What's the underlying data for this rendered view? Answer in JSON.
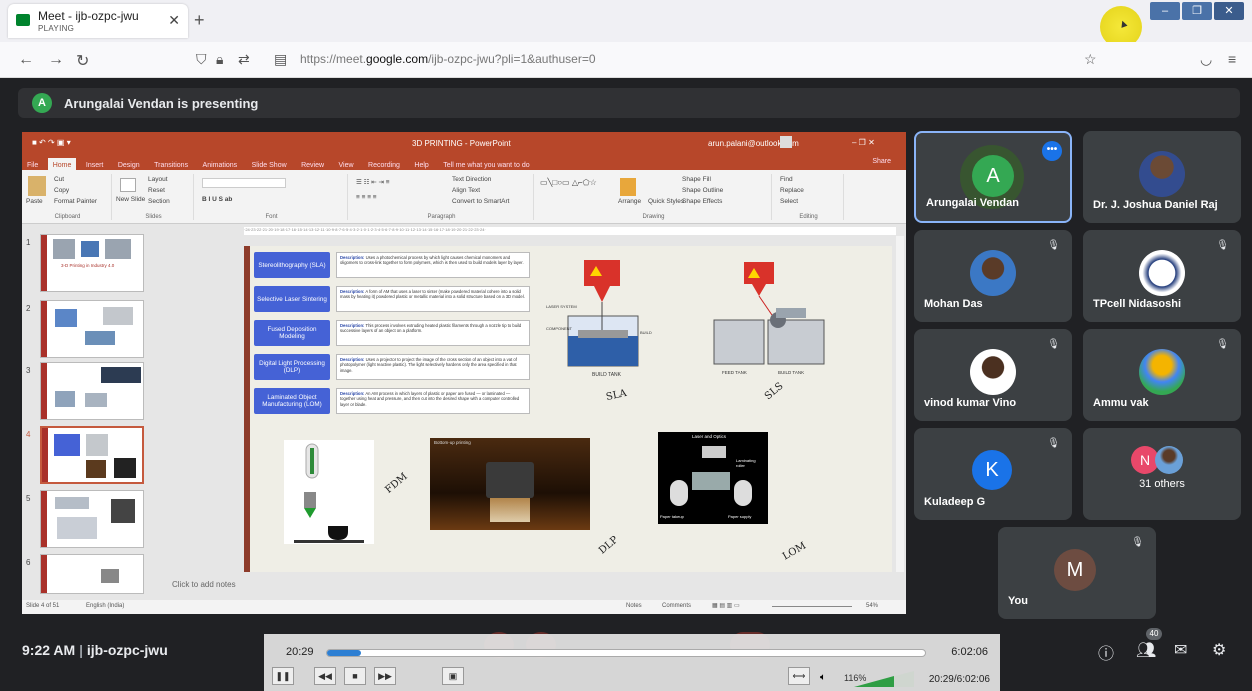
{
  "browser": {
    "tab_title": "Meet - ijb-ozpc-jwu",
    "tab_status": "PLAYING",
    "url_prefix": "https://meet.",
    "url_domain": "google.com",
    "url_path": "/ijb-ozpc-jwu?pli=1&authuser=0"
  },
  "presenter_banner": {
    "initial": "A",
    "text": "Arungalai Vendan is presenting"
  },
  "powerpoint": {
    "title": "3D PRINTING - PowerPoint",
    "user": "arun.palani@outlook.com",
    "share": "Share",
    "menu": [
      "File",
      "Home",
      "Insert",
      "Design",
      "Transitions",
      "Animations",
      "Slide Show",
      "Review",
      "View",
      "Recording",
      "Help",
      "Tell me what you want to do"
    ],
    "ribbon": {
      "clipboard": [
        "Cut",
        "Copy",
        "Format Painter",
        "Paste",
        "Clipboard"
      ],
      "slides": [
        "Layout",
        "Reset",
        "Section",
        "New Slide",
        "Slides"
      ],
      "font": "Font",
      "paragraph": "Paragraph",
      "text_dir": [
        "Text Direction",
        "Align Text",
        "Convert to SmartArt"
      ],
      "drawing": [
        "Arrange",
        "Quick Styles",
        "Shape Fill",
        "Shape Outline",
        "Shape Effects",
        "Drawing"
      ],
      "editing": [
        "Find",
        "Replace",
        "Select",
        "Editing"
      ]
    },
    "slide_numbers": [
      "1",
      "2",
      "3",
      "4",
      "5",
      "6"
    ],
    "thumb1_text": "3-D Printing in Industry 4.0",
    "notes_placeholder": "Click to add notes",
    "status_left": "Slide 4 of 51",
    "status_lang": "English (India)",
    "status_notes": "Notes",
    "status_comments": "Comments",
    "zoom": "54%"
  },
  "slide": {
    "techniques": [
      {
        "name": "Stereolithography (SLA)",
        "desc_label": "Description:",
        "desc": "Uses a photochemical process by which light causes chemical monomers and oligomers to cross-link together to form polymers, which is then used to build models layer by layer."
      },
      {
        "name": "Selective Laser Sintering",
        "desc_label": "Description:",
        "desc": "A form of AM that uses a laser to sinter (make powdered material cohere into a solid mass by heating it) powdered plastic or metallic material into a solid structure based on a 3D model."
      },
      {
        "name": "Fused Deposition Modeling",
        "desc_label": "Description:",
        "desc": "This process involves extruding heated plastic filaments through a nozzle tip to build successive layers of an object on a platform."
      },
      {
        "name": "Digital Light Processing (DLP)",
        "desc_label": "Description:",
        "desc": "Uses a projector to project the image of the cross section of an object into a vat of photopolymer (light reactive plastic). The light selectively hardens only the area specified in that image."
      },
      {
        "name": "Laminated Object Manufacturing (LOM)",
        "desc_label": "Description:",
        "desc": "An AM process in which layers of plastic or paper are fused — or laminated — together using heat and pressure, and then cut into the desired shape with a computer controlled layer or blade."
      }
    ],
    "build_tank": "BUILD TANK",
    "feed_tank": "FEED TANK",
    "build_tank2": "BUILD TANK",
    "laser_optics": "Laser and Optics",
    "laminating_roller": "Laminating roller",
    "paper_takeup": "Paper takeup",
    "paper_supply": "Paper supply",
    "bottom_up": "Bottom-up printing",
    "hand_sla": "SLA",
    "hand_sls": "SLS",
    "hand_fdm": "FDM",
    "hand_dlp": "DLP",
    "hand_lom": "LOM"
  },
  "participants": [
    {
      "name": "Arungalai Vendan",
      "initial": "A",
      "color": "#34a853",
      "muted": false
    },
    {
      "name": "Dr. J. Joshua Daniel Raj",
      "muted": false
    },
    {
      "name": "Mohan Das",
      "muted": true
    },
    {
      "name": "TPcell Nidasoshi",
      "muted": true
    },
    {
      "name": "vinod kumar Vino",
      "muted": true
    },
    {
      "name": "Ammu vak",
      "muted": true
    },
    {
      "name": "Kuladeep G",
      "initial": "K",
      "color": "#1a73e8",
      "muted": true
    },
    {
      "name": "31 others",
      "initial": "N",
      "color": "#e8486a",
      "muted": false
    },
    {
      "name": "You",
      "initial": "M",
      "color": "#6d4c41",
      "muted": true
    }
  ],
  "meeting": {
    "clock": "9:22 AM",
    "separator": "|",
    "code": "ijb-ozpc-jwu",
    "people_count": "40"
  },
  "player": {
    "current": "20:29",
    "duration": "6:02:06",
    "progress": 0.057,
    "volume": "116%",
    "stamp": "20:29/6:02:06"
  },
  "colors": {
    "meet_bg": "#202124",
    "tile_bg": "#3c4043",
    "ppt_accent": "#b7472a",
    "technique_box": "#4562d6"
  }
}
